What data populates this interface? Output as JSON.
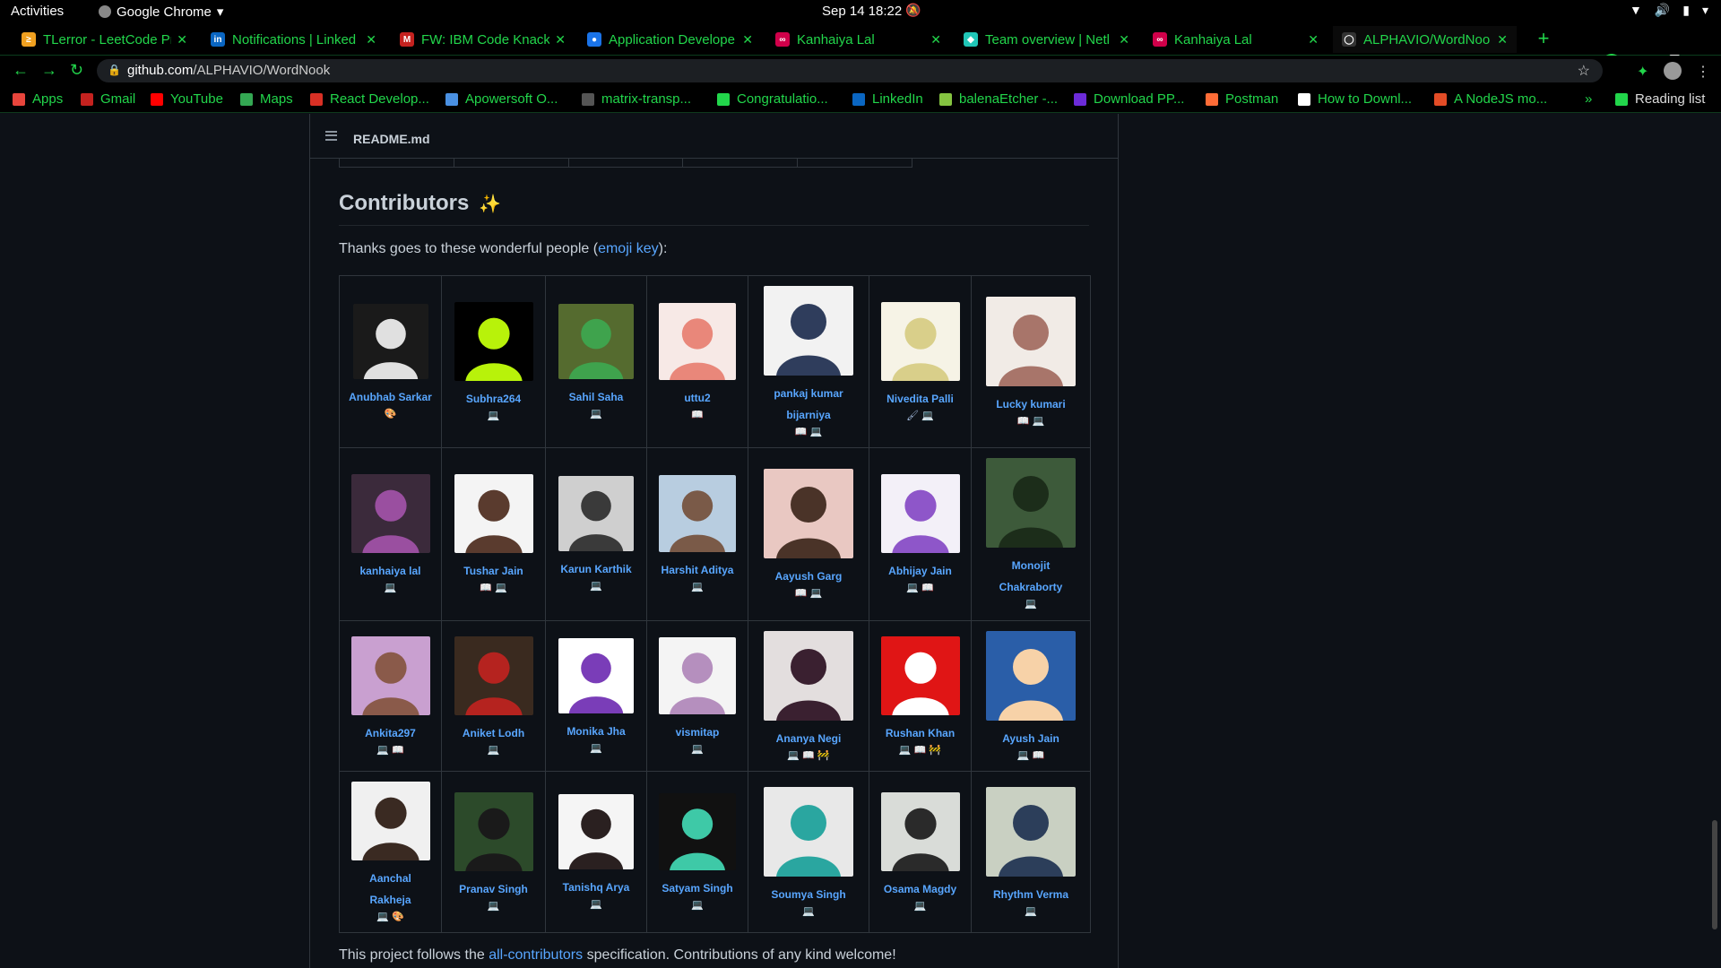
{
  "system": {
    "activities": "Activities",
    "app_name": "Google Chrome",
    "clock": "Sep 14  18:22"
  },
  "tabs": [
    {
      "label": "TLerror - LeetCode Pr",
      "favicon_color": "#f0a020",
      "favicon_glyph": "≥"
    },
    {
      "label": "Notifications | Linked",
      "favicon_color": "#0a66c2",
      "favicon_glyph": "in"
    },
    {
      "label": "FW: IBM Code Knack",
      "favicon_color": "#c5221f",
      "favicon_glyph": "M"
    },
    {
      "label": "Application Develope",
      "favicon_color": "#1a73e8",
      "favicon_glyph": "●"
    },
    {
      "label": "Kanhaiya Lal",
      "favicon_color": "#d1004a",
      "favicon_glyph": "∞"
    },
    {
      "label": "Team overview | Netl",
      "favicon_color": "#20c6b7",
      "favicon_glyph": "◆"
    },
    {
      "label": "Kanhaiya Lal",
      "favicon_color": "#d1004a",
      "favicon_glyph": "∞"
    },
    {
      "label": "ALPHAVIO/WordNoo",
      "favicon_color": "#333333",
      "favicon_glyph": "◯"
    }
  ],
  "omnibox": {
    "host": "github.com",
    "path": "/ALPHAVIO/WordNook"
  },
  "bookmarks": [
    {
      "label": "Apps",
      "color": "#e8453c"
    },
    {
      "label": "Gmail",
      "color": "#c5221f"
    },
    {
      "label": "YouTube",
      "color": "#ff0000"
    },
    {
      "label": "Maps",
      "color": "#34a853"
    },
    {
      "label": "React Develop...",
      "color": "#d93025"
    },
    {
      "label": "Apowersoft O...",
      "color": "#4a90e2"
    },
    {
      "label": "matrix-transp...",
      "color": "#555555"
    },
    {
      "label": "Congratulatio...",
      "color": "#22d64b"
    },
    {
      "label": "LinkedIn",
      "color": "#0a66c2"
    },
    {
      "label": "balenaEtcher -...",
      "color": "#85c441"
    },
    {
      "label": "Download PP...",
      "color": "#6c2bd9"
    },
    {
      "label": "Postman",
      "color": "#ff6c37"
    },
    {
      "label": "How to Downl...",
      "color": "#ffffff"
    },
    {
      "label": "A NodeJS mo...",
      "color": "#e34c26"
    }
  ],
  "reading_list": "Reading list",
  "readme": {
    "filename": "README.md",
    "heading": "Contributors",
    "heading_emoji": "✨",
    "thanks_prefix": "Thanks goes to these wonderful people (",
    "thanks_link": "emoji key",
    "thanks_suffix": "):",
    "footer_prefix": "This project follows the ",
    "footer_link": "all-contributors",
    "footer_suffix": " specification. Contributions of any kind welcome!"
  },
  "contributors": [
    [
      {
        "name": "Anubhab Sarkar",
        "icons": "🎨",
        "avatar_bg": "#1a1a1a",
        "avatar_fg": "#e0e0e0"
      },
      {
        "name": "Subhra264",
        "icons": "💻",
        "avatar_bg": "#000000",
        "avatar_fg": "#b8f20a"
      },
      {
        "name": "Sahil Saha",
        "icons": "💻",
        "avatar_bg": "#556b2f",
        "avatar_fg": "#3fa34d"
      },
      {
        "name": "uttu2",
        "icons": "📖",
        "avatar_bg": "#f7e9e6",
        "avatar_fg": "#e9877a"
      },
      {
        "name": "pankaj kumar bijarniya",
        "icons": "📖 💻",
        "avatar_bg": "#f2f2f2",
        "avatar_fg": "#2f3d5c"
      },
      {
        "name": "Nivedita Palli",
        "icons": "🖌 💻",
        "avatar_bg": "#f6f3e6",
        "avatar_fg": "#d9cf8a"
      },
      {
        "name": "Lucky kumari",
        "icons": "📖 💻",
        "avatar_bg": "#f1ebe6",
        "avatar_fg": "#a8756a"
      }
    ],
    [
      {
        "name": "kanhaiya lal",
        "icons": "💻",
        "avatar_bg": "#3b2a3b",
        "avatar_fg": "#9a4fa0"
      },
      {
        "name": "Tushar Jain",
        "icons": "📖 💻",
        "avatar_bg": "#f4f4f4",
        "avatar_fg": "#5a3b2e"
      },
      {
        "name": "Karun Karthik",
        "icons": "💻",
        "avatar_bg": "#cfcfcf",
        "avatar_fg": "#3a3a3a"
      },
      {
        "name": "Harshit Aditya",
        "icons": "💻",
        "avatar_bg": "#b8cde0",
        "avatar_fg": "#7a5a48"
      },
      {
        "name": "Aayush Garg",
        "icons": "📖 💻",
        "avatar_bg": "#e9c8c2",
        "avatar_fg": "#4a3328"
      },
      {
        "name": "Abhijay Jain",
        "icons": "💻 📖",
        "avatar_bg": "#f3f0f8",
        "avatar_fg": "#8e56c9"
      },
      {
        "name": "Monojit Chakraborty",
        "icons": "💻",
        "avatar_bg": "#3d5a3a",
        "avatar_fg": "#1c2d1a"
      }
    ],
    [
      {
        "name": "Ankita297",
        "icons": "💻 📖",
        "avatar_bg": "#c9a0d0",
        "avatar_fg": "#8a5a4a"
      },
      {
        "name": "Aniket Lodh",
        "icons": "💻",
        "avatar_bg": "#3a2a1f",
        "avatar_fg": "#b5231f"
      },
      {
        "name": "Monika Jha",
        "icons": "💻",
        "avatar_bg": "#ffffff",
        "avatar_fg": "#7a3db8"
      },
      {
        "name": "vismitap",
        "icons": "💻",
        "avatar_bg": "#f4f4f4",
        "avatar_fg": "#b58fbe"
      },
      {
        "name": "Ananya Negi",
        "icons": "💻 📖 🚧",
        "avatar_bg": "#e3dede",
        "avatar_fg": "#3a2030"
      },
      {
        "name": "Rushan Khan",
        "icons": "💻 📖 🚧",
        "avatar_bg": "#e01515",
        "avatar_fg": "#ffffff"
      },
      {
        "name": "Ayush Jain",
        "icons": "💻 📖",
        "avatar_bg": "#2a5ea8",
        "avatar_fg": "#f7d2a8"
      }
    ],
    [
      {
        "name": "Aanchal Rakheja",
        "icons": "💻 🎨",
        "avatar_bg": "#f0f0f0",
        "avatar_fg": "#3a2a22"
      },
      {
        "name": "Pranav Singh",
        "icons": "💻",
        "avatar_bg": "#2c4a2a",
        "avatar_fg": "#1a1a1a"
      },
      {
        "name": "Tanishq Arya",
        "icons": "💻",
        "avatar_bg": "#f5f5f5",
        "avatar_fg": "#2a2020"
      },
      {
        "name": "Satyam Singh",
        "icons": "💻",
        "avatar_bg": "#111111",
        "avatar_fg": "#3ec9a7"
      },
      {
        "name": "Soumya Singh",
        "icons": "💻",
        "avatar_bg": "#e8e8e8",
        "avatar_fg": "#2aa6a0"
      },
      {
        "name": "Osama Magdy",
        "icons": "💻",
        "avatar_bg": "#d9dcd8",
        "avatar_fg": "#2a2a2a"
      },
      {
        "name": "Rhythm Verma",
        "icons": "💻",
        "avatar_bg": "#c9d0c2",
        "avatar_fg": "#2c3e5a"
      }
    ]
  ]
}
